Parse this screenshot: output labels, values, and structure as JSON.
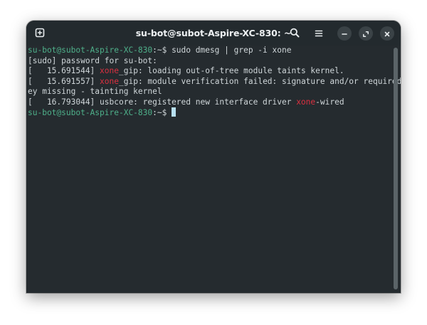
{
  "window": {
    "title": "su-bot@subot-Aspire-XC-830: ~"
  },
  "terminal": {
    "lines": [
      [
        {
          "text": "su-bot@subot-Aspire-XC-830",
          "style": "user"
        },
        {
          "text": ":~$ sudo dmesg | grep -i xone",
          "style": "plain"
        }
      ],
      [
        {
          "text": "[sudo] password for su-bot:",
          "style": "plain"
        }
      ],
      [
        {
          "text": "[   15.691544] ",
          "style": "plain"
        },
        {
          "text": "xone",
          "style": "match"
        },
        {
          "text": "_gip: loading out-of-tree module taints kernel.",
          "style": "plain"
        }
      ],
      [
        {
          "text": "[   15.691557] ",
          "style": "plain"
        },
        {
          "text": "xone",
          "style": "match"
        },
        {
          "text": "_gip: module verification failed: signature and/or required k",
          "style": "plain"
        }
      ],
      [
        {
          "text": "ey missing - tainting kernel",
          "style": "plain"
        }
      ],
      [
        {
          "text": "[   16.793044] usbcore: registered new interface driver ",
          "style": "plain"
        },
        {
          "text": "xone",
          "style": "match"
        },
        {
          "text": "-wired",
          "style": "plain"
        }
      ],
      [
        {
          "text": "su-bot@subot-Aspire-XC-830",
          "style": "user"
        },
        {
          "text": ":~$ ",
          "style": "plain"
        },
        {
          "text": "",
          "style": "cursor"
        }
      ]
    ]
  },
  "icons": {
    "new_tab": "new-tab-icon",
    "search": "search-icon",
    "menu": "hamburger-menu-icon",
    "minimize": "minimize-icon",
    "maximize": "maximize-icon",
    "close": "close-icon"
  },
  "colors": {
    "background": "#252b2f",
    "titlebar": "#232a2e",
    "text": "#cfd6d9",
    "prompt": "#4eb08a",
    "match": "#dd3040",
    "cursor": "#b8e0f0"
  }
}
